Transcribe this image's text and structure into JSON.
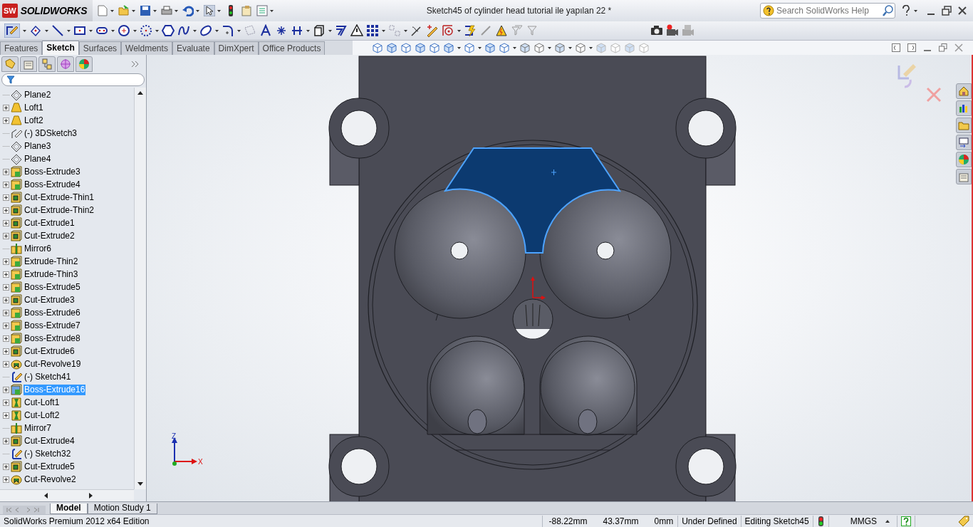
{
  "title_bar": {
    "app_badge": "SW",
    "app_name": "SOLIDWORKS",
    "title": "Sketch45 of cylinder head tutorial ile yapılan 22 *",
    "search": {
      "placeholder": "Search SolidWorks Help"
    }
  },
  "command_tabs": [
    {
      "label": "Features",
      "selected": false
    },
    {
      "label": "Sketch",
      "selected": true
    },
    {
      "label": "Surfaces",
      "selected": false
    },
    {
      "label": "Weldments",
      "selected": false
    },
    {
      "label": "Evaluate",
      "selected": false
    },
    {
      "label": "DimXpert",
      "selected": false
    },
    {
      "label": "Office Products",
      "selected": false
    }
  ],
  "feature_tree": {
    "items": [
      {
        "label": "Plane2",
        "kind": "plane",
        "expandable": false,
        "selected": false
      },
      {
        "label": "Loft1",
        "kind": "loft",
        "expandable": true,
        "selected": false
      },
      {
        "label": "Loft2",
        "kind": "loft",
        "expandable": true,
        "selected": false
      },
      {
        "label": "(-) 3DSketch3",
        "kind": "sketch3d",
        "expandable": false,
        "selected": false
      },
      {
        "label": "Plane3",
        "kind": "plane",
        "expandable": false,
        "selected": false
      },
      {
        "label": "Plane4",
        "kind": "plane",
        "expandable": false,
        "selected": false
      },
      {
        "label": "Boss-Extrude3",
        "kind": "boss",
        "expandable": true,
        "selected": false
      },
      {
        "label": "Boss-Extrude4",
        "kind": "boss",
        "expandable": true,
        "selected": false
      },
      {
        "label": "Cut-Extrude-Thin1",
        "kind": "cut",
        "expandable": true,
        "selected": false
      },
      {
        "label": "Cut-Extrude-Thin2",
        "kind": "cut",
        "expandable": true,
        "selected": false
      },
      {
        "label": "Cut-Extrude1",
        "kind": "cut",
        "expandable": true,
        "selected": false
      },
      {
        "label": "Cut-Extrude2",
        "kind": "cut",
        "expandable": true,
        "selected": false
      },
      {
        "label": "Mirror6",
        "kind": "mirror",
        "expandable": false,
        "selected": false
      },
      {
        "label": "Extrude-Thin2",
        "kind": "boss",
        "expandable": true,
        "selected": false
      },
      {
        "label": "Extrude-Thin3",
        "kind": "boss",
        "expandable": true,
        "selected": false
      },
      {
        "label": "Boss-Extrude5",
        "kind": "boss",
        "expandable": true,
        "selected": false
      },
      {
        "label": "Cut-Extrude3",
        "kind": "cut",
        "expandable": true,
        "selected": false
      },
      {
        "label": "Boss-Extrude6",
        "kind": "boss",
        "expandable": true,
        "selected": false
      },
      {
        "label": "Boss-Extrude7",
        "kind": "boss",
        "expandable": true,
        "selected": false
      },
      {
        "label": "Boss-Extrude8",
        "kind": "boss",
        "expandable": true,
        "selected": false
      },
      {
        "label": "Cut-Extrude6",
        "kind": "cut",
        "expandable": true,
        "selected": false
      },
      {
        "label": "Cut-Revolve19",
        "kind": "revolve",
        "expandable": true,
        "selected": false
      },
      {
        "label": "(-) Sketch41",
        "kind": "sketch",
        "expandable": false,
        "selected": false
      },
      {
        "label": "Boss-Extrude16",
        "kind": "boss",
        "expandable": true,
        "selected": true
      },
      {
        "label": "Cut-Loft1",
        "kind": "cutloft",
        "expandable": true,
        "selected": false
      },
      {
        "label": "Cut-Loft2",
        "kind": "cutloft",
        "expandable": true,
        "selected": false
      },
      {
        "label": "Mirror7",
        "kind": "mirror",
        "expandable": false,
        "selected": false
      },
      {
        "label": "Cut-Extrude4",
        "kind": "cut",
        "expandable": true,
        "selected": false
      },
      {
        "label": "(-) Sketch32",
        "kind": "sketch",
        "expandable": false,
        "selected": false
      },
      {
        "label": "Cut-Extrude5",
        "kind": "cut",
        "expandable": true,
        "selected": false
      },
      {
        "label": "Cut-Revolve2",
        "kind": "revolve",
        "expandable": true,
        "selected": false
      }
    ]
  },
  "triad": {
    "z_label": "Z",
    "x_label": "X"
  },
  "bottom_tabs": [
    {
      "label": "Model",
      "selected": true
    },
    {
      "label": "Motion Study 1",
      "selected": false
    }
  ],
  "status_bar": {
    "edition": "SolidWorks Premium 2012 x64 Edition",
    "x": "-88.22mm",
    "y": "43.37mm",
    "z": "0mm",
    "sketch_state": "Under Defined",
    "editing": "Editing Sketch45",
    "units": "MMGS"
  }
}
